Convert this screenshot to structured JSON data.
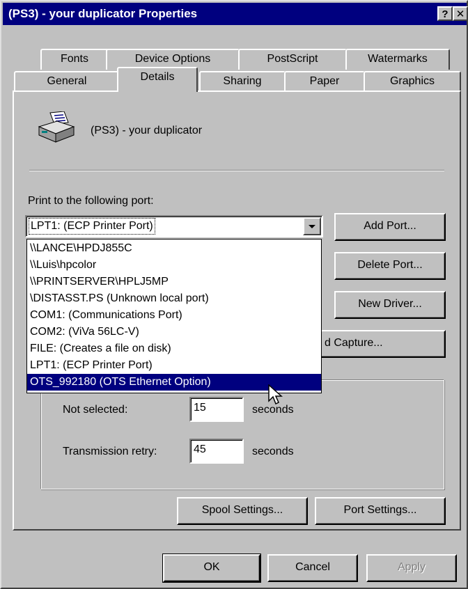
{
  "window": {
    "title": "(PS3) - your duplicator Properties",
    "help_glyph": "?",
    "close_glyph": "✕"
  },
  "tabs": {
    "row1": [
      {
        "label": "Fonts"
      },
      {
        "label": "Device Options"
      },
      {
        "label": "PostScript"
      },
      {
        "label": "Watermarks"
      }
    ],
    "row2": [
      {
        "label": "General"
      },
      {
        "label": "Details",
        "active": true
      },
      {
        "label": "Sharing"
      },
      {
        "label": "Paper"
      },
      {
        "label": "Graphics"
      }
    ]
  },
  "printer": {
    "name": "(PS3) - your duplicator",
    "icon": "printer-icon"
  },
  "port": {
    "label": "Print to the following port:",
    "selected_value": "LPT1:  (ECP Printer Port)",
    "options": [
      "\\\\LANCE\\HPDJ855C",
      "\\\\Luis\\hpcolor",
      "\\\\PRINTSERVER\\HPLJ5MP",
      "\\DISTASST.PS  (Unknown local port)",
      "COM1:  (Communications Port)",
      "COM2:  (ViVa 56LC-V)",
      "FILE:  (Creates a file on disk)",
      "LPT1:  (ECP Printer Port)",
      "OTS_992180  (OTS Ethernet Option)"
    ],
    "highlighted_index": 8
  },
  "side_buttons": {
    "add_port": "Add Port...",
    "delete_port": "Delete Port...",
    "new_driver": "New Driver...",
    "capture_partial": "d Capture..."
  },
  "timeouts": {
    "not_selected_label": "Not selected:",
    "not_selected_value": "15",
    "not_selected_unit": "seconds",
    "retry_label": "Transmission retry:",
    "retry_value": "45",
    "retry_unit": "seconds"
  },
  "bottom_buttons": {
    "spool_settings": "Spool Settings...",
    "port_settings": "Port Settings..."
  },
  "dialog_buttons": {
    "ok": "OK",
    "cancel": "Cancel",
    "apply": "Apply"
  },
  "colors": {
    "face": "#c0c0c0",
    "titlebar": "#00007f",
    "selection": "#00007f"
  }
}
